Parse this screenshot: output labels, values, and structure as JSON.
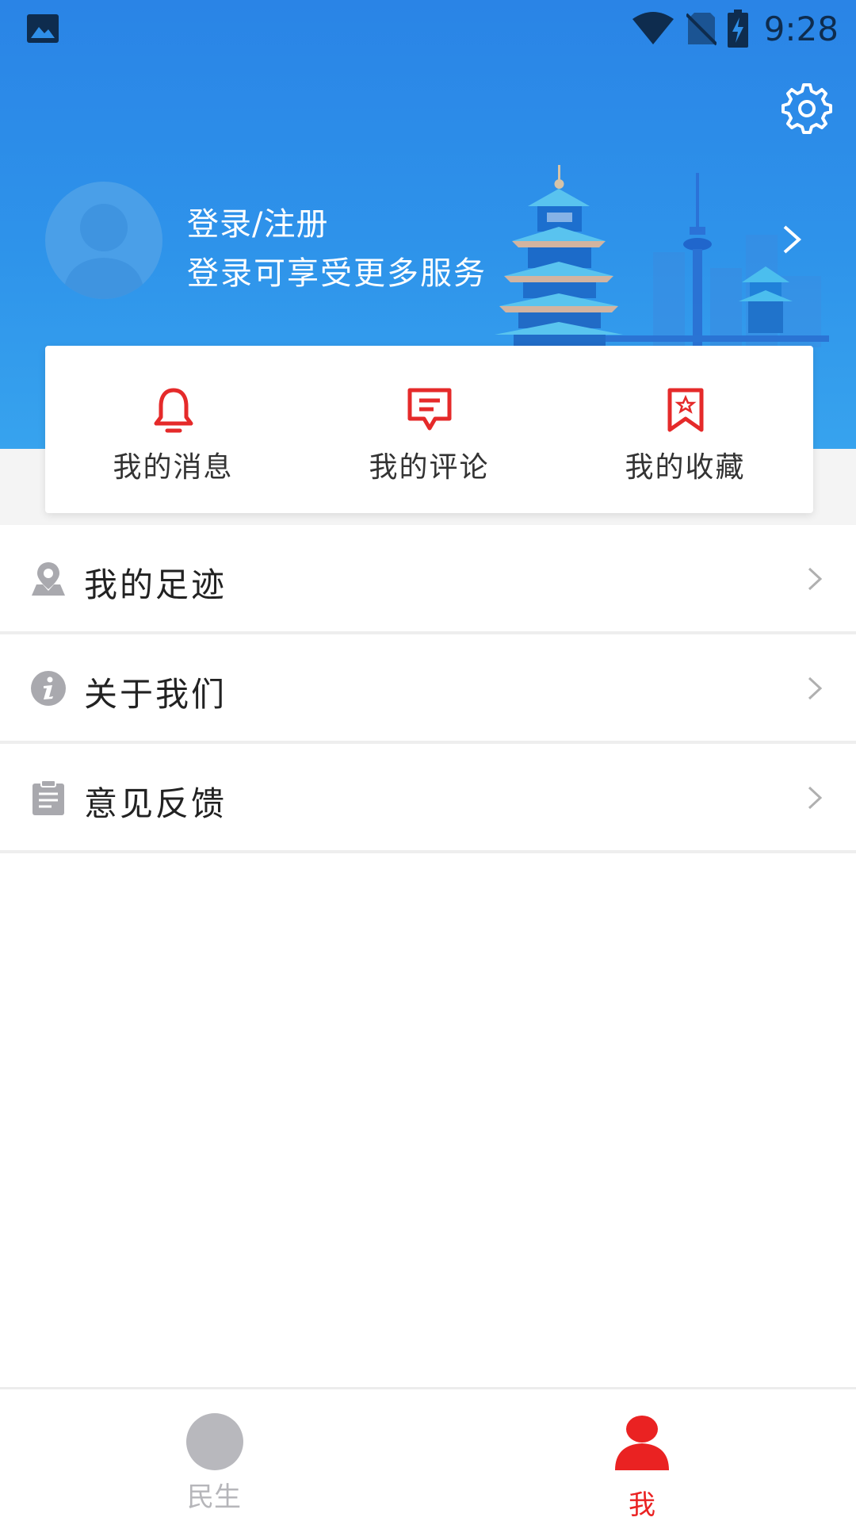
{
  "status_bar": {
    "time": "9:28"
  },
  "profile": {
    "title": "登录/注册",
    "subtitle": "登录可享受更多服务"
  },
  "quick_actions": [
    {
      "label": "我的消息",
      "icon": "bell-icon"
    },
    {
      "label": "我的评论",
      "icon": "comment-icon"
    },
    {
      "label": "我的收藏",
      "icon": "bookmark-star-icon"
    }
  ],
  "menu": [
    {
      "label": "我的足迹",
      "icon": "location-pin-icon"
    },
    {
      "label": "关于我们",
      "icon": "info-icon"
    },
    {
      "label": "意见反馈",
      "icon": "clipboard-icon"
    }
  ],
  "tabs": [
    {
      "label": "民生",
      "active": false
    },
    {
      "label": "我",
      "active": true
    }
  ],
  "colors": {
    "header_blue": "#2e8fe9",
    "accent_red": "#ea2222",
    "inactive_gray": "#b6b6ba"
  }
}
